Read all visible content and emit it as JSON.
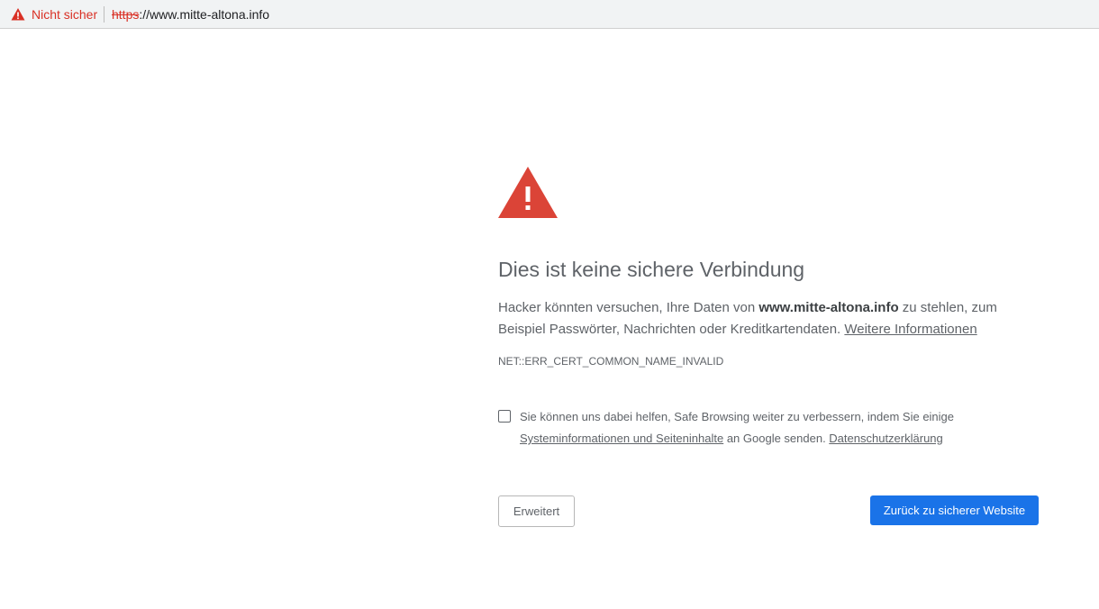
{
  "omnibox": {
    "status_text": "Nicht sicher",
    "url_scheme": "https",
    "url_rest": "://www.mitte-altona.info",
    "warning_icon": "warning-triangle-icon",
    "status_color": "#d93025"
  },
  "interstitial": {
    "icon": "warning-triangle-icon",
    "icon_color": "#db4437",
    "title": "Dies ist keine sichere Verbindung",
    "desc_part1": "Hacker könnten versuchen, Ihre Daten von ",
    "domain": "www.mitte-altona.info",
    "desc_part2": " zu stehlen, zum Beispiel Passwörter, Nachrichten oder Kreditkartendaten. ",
    "learn_more": "Weitere Informationen",
    "error_code": "NET::ERR_CERT_COMMON_NAME_INVALID",
    "optin": {
      "checked": false,
      "text1": "Sie können uns dabei helfen, Safe Browsing weiter zu verbessern, indem Sie einige ",
      "link1": "Systeminformationen und Seiteninhalte",
      "text2": " an Google senden. ",
      "link2": "Datenschutzerklärung"
    },
    "advanced_button": "Erweitert",
    "back_button": "Zurück zu sicherer Website",
    "primary_color": "#1a73e8"
  }
}
